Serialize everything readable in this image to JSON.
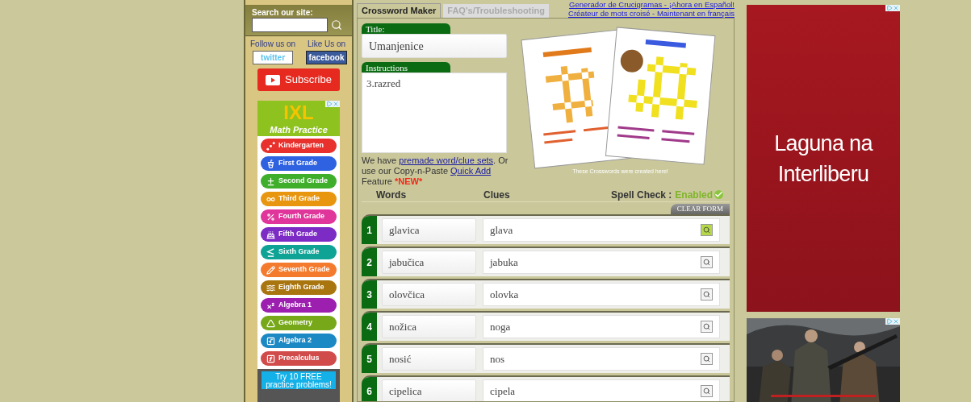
{
  "sidebar": {
    "search": {
      "label": "Search our site:"
    },
    "follow": {
      "label": "Follow us on",
      "button": "twitter"
    },
    "like": {
      "label": "Like Us on",
      "button": "facebook"
    },
    "subscribe": "Subscribe",
    "ad": {
      "logo": "IXL",
      "subtitle": "Math Practice",
      "grades": [
        {
          "label": "Kindergarten",
          "color": "#e8302c"
        },
        {
          "label": "First Grade",
          "color": "#2f62e0"
        },
        {
          "label": "Second Grade",
          "color": "#3fae2a"
        },
        {
          "label": "Third Grade",
          "color": "#e8960f"
        },
        {
          "label": "Fourth Grade",
          "color": "#e0359a"
        },
        {
          "label": "Fifth Grade",
          "color": "#7c2bc4"
        },
        {
          "label": "Sixth Grade",
          "color": "#0ea395"
        },
        {
          "label": "Seventh Grade",
          "color": "#f47a2e"
        },
        {
          "label": "Eighth Grade",
          "color": "#a9750f"
        },
        {
          "label": "Algebra 1",
          "color": "#9c1fb0"
        },
        {
          "label": "Geometry",
          "color": "#77a81a"
        },
        {
          "label": "Algebra 2",
          "color": "#1c88c4"
        },
        {
          "label": "Precalculus",
          "color": "#d14b4b"
        }
      ],
      "cta": "Try 10 FREE practice problems!"
    }
  },
  "tabs": [
    {
      "label": "Crossword Maker",
      "selected": true
    },
    {
      "label": "FAQ's/Troubleshooting",
      "selected": false
    }
  ],
  "language_links": [
    "Generador de Crucigramas - ¡Ahora en Español!",
    "Créateur de mots croisé - Maintenant en français"
  ],
  "form": {
    "title_label": "Title:",
    "title_value": "Umanjenice",
    "instructions_label": "Instructions",
    "instructions_value": "3.razred",
    "note_parts": [
      "We have ",
      "premade word/clue sets",
      ". Or use our Copy-n-Paste ",
      "Quick Add",
      " Feature ",
      "*NEW*"
    ],
    "caption": "These Crosswords were created here!"
  },
  "columns": {
    "words": "Words",
    "clues": "Clues",
    "spell_check_label": "Spell Check :",
    "spell_check_value": "Enabled",
    "spell_check_on": true
  },
  "clear_form": "CLEAR FORM",
  "rows": [
    {
      "number": "1",
      "word": "glavica",
      "clue": "glava",
      "highlighted": true
    },
    {
      "number": "2",
      "word": "jabučica",
      "clue": "jabuka",
      "highlighted": false
    },
    {
      "number": "3",
      "word": "olovčica",
      "clue": "olovka",
      "highlighted": false
    },
    {
      "number": "4",
      "word": "nožica",
      "clue": "noga",
      "highlighted": false
    },
    {
      "number": "5",
      "word": "nosić",
      "clue": "nos",
      "highlighted": false
    },
    {
      "number": "6",
      "word": "cipelica",
      "clue": "cipela",
      "highlighted": false
    }
  ],
  "ads": [
    {
      "headline": "Laguna na Interliberu"
    },
    {
      "kind": "picture"
    }
  ]
}
